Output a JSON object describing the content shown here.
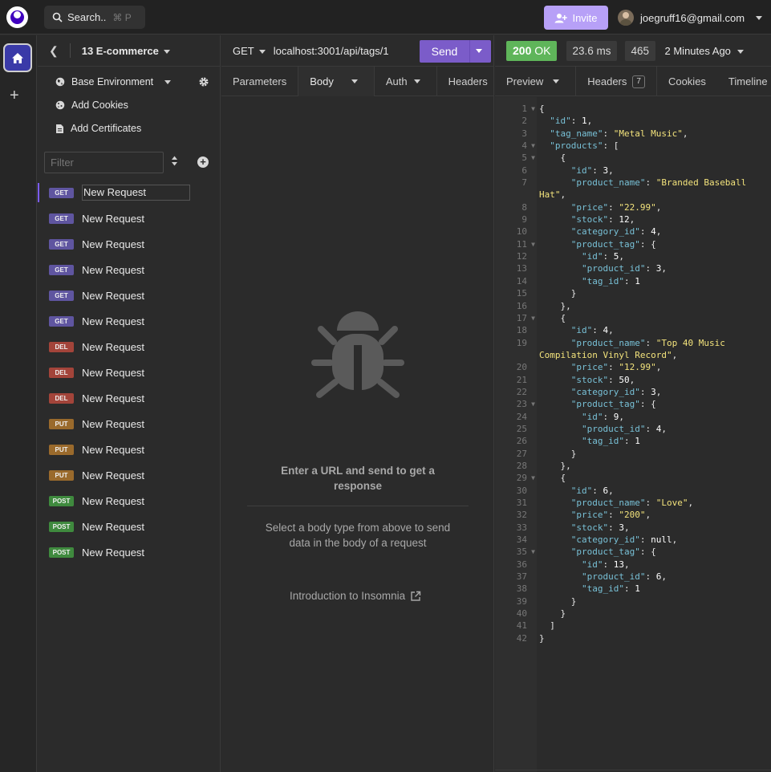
{
  "topbar": {
    "search_label": "Search..",
    "search_shortcut": "⌘ P",
    "invite_label": "Invite",
    "account_email": "joegruff16@gmail.com"
  },
  "project": {
    "name": "13 E-commerce",
    "environment": "Base Environment",
    "add_cookies": "Add Cookies",
    "add_certificates": "Add Certificates",
    "filter_placeholder": "Filter"
  },
  "requests": [
    {
      "method": "GET",
      "name": "New Request"
    },
    {
      "method": "GET",
      "name": "New Request"
    },
    {
      "method": "GET",
      "name": "New Request"
    },
    {
      "method": "GET",
      "name": "New Request"
    },
    {
      "method": "GET",
      "name": "New Request"
    },
    {
      "method": "GET",
      "name": "New Request"
    },
    {
      "method": "DEL",
      "name": "New Request"
    },
    {
      "method": "DEL",
      "name": "New Request"
    },
    {
      "method": "DEL",
      "name": "New Request"
    },
    {
      "method": "PUT",
      "name": "New Request"
    },
    {
      "method": "PUT",
      "name": "New Request"
    },
    {
      "method": "PUT",
      "name": "New Request"
    },
    {
      "method": "POST",
      "name": "New Request"
    },
    {
      "method": "POST",
      "name": "New Request"
    },
    {
      "method": "POST",
      "name": "New Request"
    }
  ],
  "request": {
    "method": "GET",
    "url": "localhost:3001/api/tags/1",
    "send_label": "Send",
    "tabs": [
      "Parameters",
      "Body",
      "Auth",
      "Headers"
    ],
    "empty_title": "Enter a URL and send to get a response",
    "empty_body": "Select a body type from above to send data in the body of a request",
    "intro_link": "Introduction to Insomnia"
  },
  "response": {
    "status_code": "200",
    "status_text": "OK",
    "time": "23.6 ms",
    "size": "465 B",
    "time_ago": "2 Minutes Ago",
    "tabs": {
      "preview": "Preview",
      "headers": "Headers",
      "headers_count": "7",
      "cookies": "Cookies",
      "timeline": "Timeline"
    },
    "code_lines": [
      "{",
      "  \"id\": 1,",
      "  \"tag_name\": \"Metal Music\",",
      "  \"products\": [",
      "    {",
      "      \"id\": 3,",
      "      \"product_name\": \"Branded Baseball Hat\",",
      "      \"price\": \"22.99\",",
      "      \"stock\": 12,",
      "      \"category_id\": 4,",
      "      \"product_tag\": {",
      "        \"id\": 5,",
      "        \"product_id\": 3,",
      "        \"tag_id\": 1",
      "      }",
      "    },",
      "    {",
      "      \"id\": 4,",
      "      \"product_name\": \"Top 40 Music Compilation Vinyl Record\",",
      "      \"price\": \"12.99\",",
      "      \"stock\": 50,",
      "      \"category_id\": 3,",
      "      \"product_tag\": {",
      "        \"id\": 9,",
      "        \"product_id\": 4,",
      "        \"tag_id\": 1",
      "      }",
      "    },",
      "    {",
      "      \"id\": 6,",
      "      \"product_name\": \"Love\",",
      "      \"price\": \"200\",",
      "      \"stock\": 3,",
      "      \"category_id\": null,",
      "      \"product_tag\": {",
      "        \"id\": 13,",
      "        \"product_id\": 6,",
      "        \"tag_id\": 1",
      "      }",
      "    }",
      "  ]",
      "}"
    ]
  },
  "colors": {
    "accent": "#7b5cc9",
    "status_ok": "#5fb55a",
    "json_key": "#78c0d6",
    "json_string": "#f3e37c"
  },
  "icons": [
    "logo-icon",
    "search-icon",
    "add-user-icon",
    "avatar",
    "home-icon",
    "plus-icon",
    "back-icon",
    "gear-icon",
    "cookie-icon",
    "certificate-icon",
    "sort-icon",
    "add-circle-icon",
    "bug-icon",
    "external-link-icon",
    "chevron-down-icon"
  ]
}
